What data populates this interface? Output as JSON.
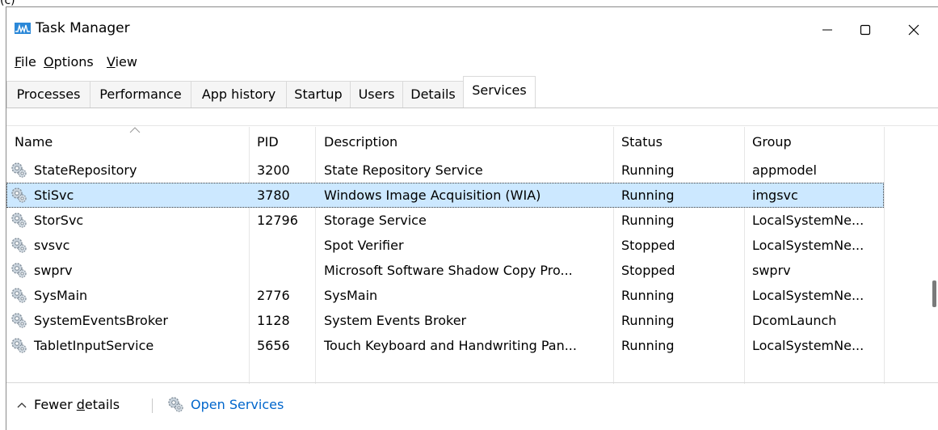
{
  "corner_text": "(c)",
  "window": {
    "title": "Task Manager",
    "menu": [
      {
        "label_pre": "",
        "label_acc": "F",
        "label_post": "ile"
      },
      {
        "label_pre": "",
        "label_acc": "O",
        "label_post": "ptions"
      },
      {
        "label_pre": "",
        "label_acc": "V",
        "label_post": "iew"
      }
    ]
  },
  "tabs": [
    "Processes",
    "Performance",
    "App history",
    "Startup",
    "Users",
    "Details",
    "Services"
  ],
  "active_tab": "Services",
  "columns": [
    "Name",
    "PID",
    "Description",
    "Status",
    "Group"
  ],
  "rows": [
    {
      "name": "StateRepository",
      "pid": "3200",
      "description": "State Repository Service",
      "status": "Running",
      "group": "appmodel"
    },
    {
      "name": "StiSvc",
      "pid": "3780",
      "description": "Windows Image Acquisition (WIA)",
      "status": "Running",
      "group": "imgsvc",
      "selected": true
    },
    {
      "name": "StorSvc",
      "pid": "12796",
      "description": "Storage Service",
      "status": "Running",
      "group": "LocalSystemNe..."
    },
    {
      "name": "svsvc",
      "pid": "",
      "description": "Spot Verifier",
      "status": "Stopped",
      "group": "LocalSystemNe..."
    },
    {
      "name": "swprv",
      "pid": "",
      "description": "Microsoft Software Shadow Copy Pro...",
      "status": "Stopped",
      "group": "swprv"
    },
    {
      "name": "SysMain",
      "pid": "2776",
      "description": "SysMain",
      "status": "Running",
      "group": "LocalSystemNe..."
    },
    {
      "name": "SystemEventsBroker",
      "pid": "1128",
      "description": "System Events Broker",
      "status": "Running",
      "group": "DcomLaunch"
    },
    {
      "name": "TabletInputService",
      "pid": "5656",
      "description": "Touch Keyboard and Handwriting Pan...",
      "status": "Running",
      "group": "LocalSystemNe..."
    }
  ],
  "footer": {
    "fewer_pre": "Fewer ",
    "fewer_acc": "d",
    "fewer_post": "etails",
    "open_services": "Open Services"
  },
  "colors": {
    "selected_row": "#cce8ff",
    "link": "#0066cc"
  },
  "icons": [
    "task-manager-icon",
    "minimize-icon",
    "maximize-icon",
    "close-icon",
    "gear-icon",
    "chevron-up-icon",
    "sort-ascending-icon"
  ]
}
